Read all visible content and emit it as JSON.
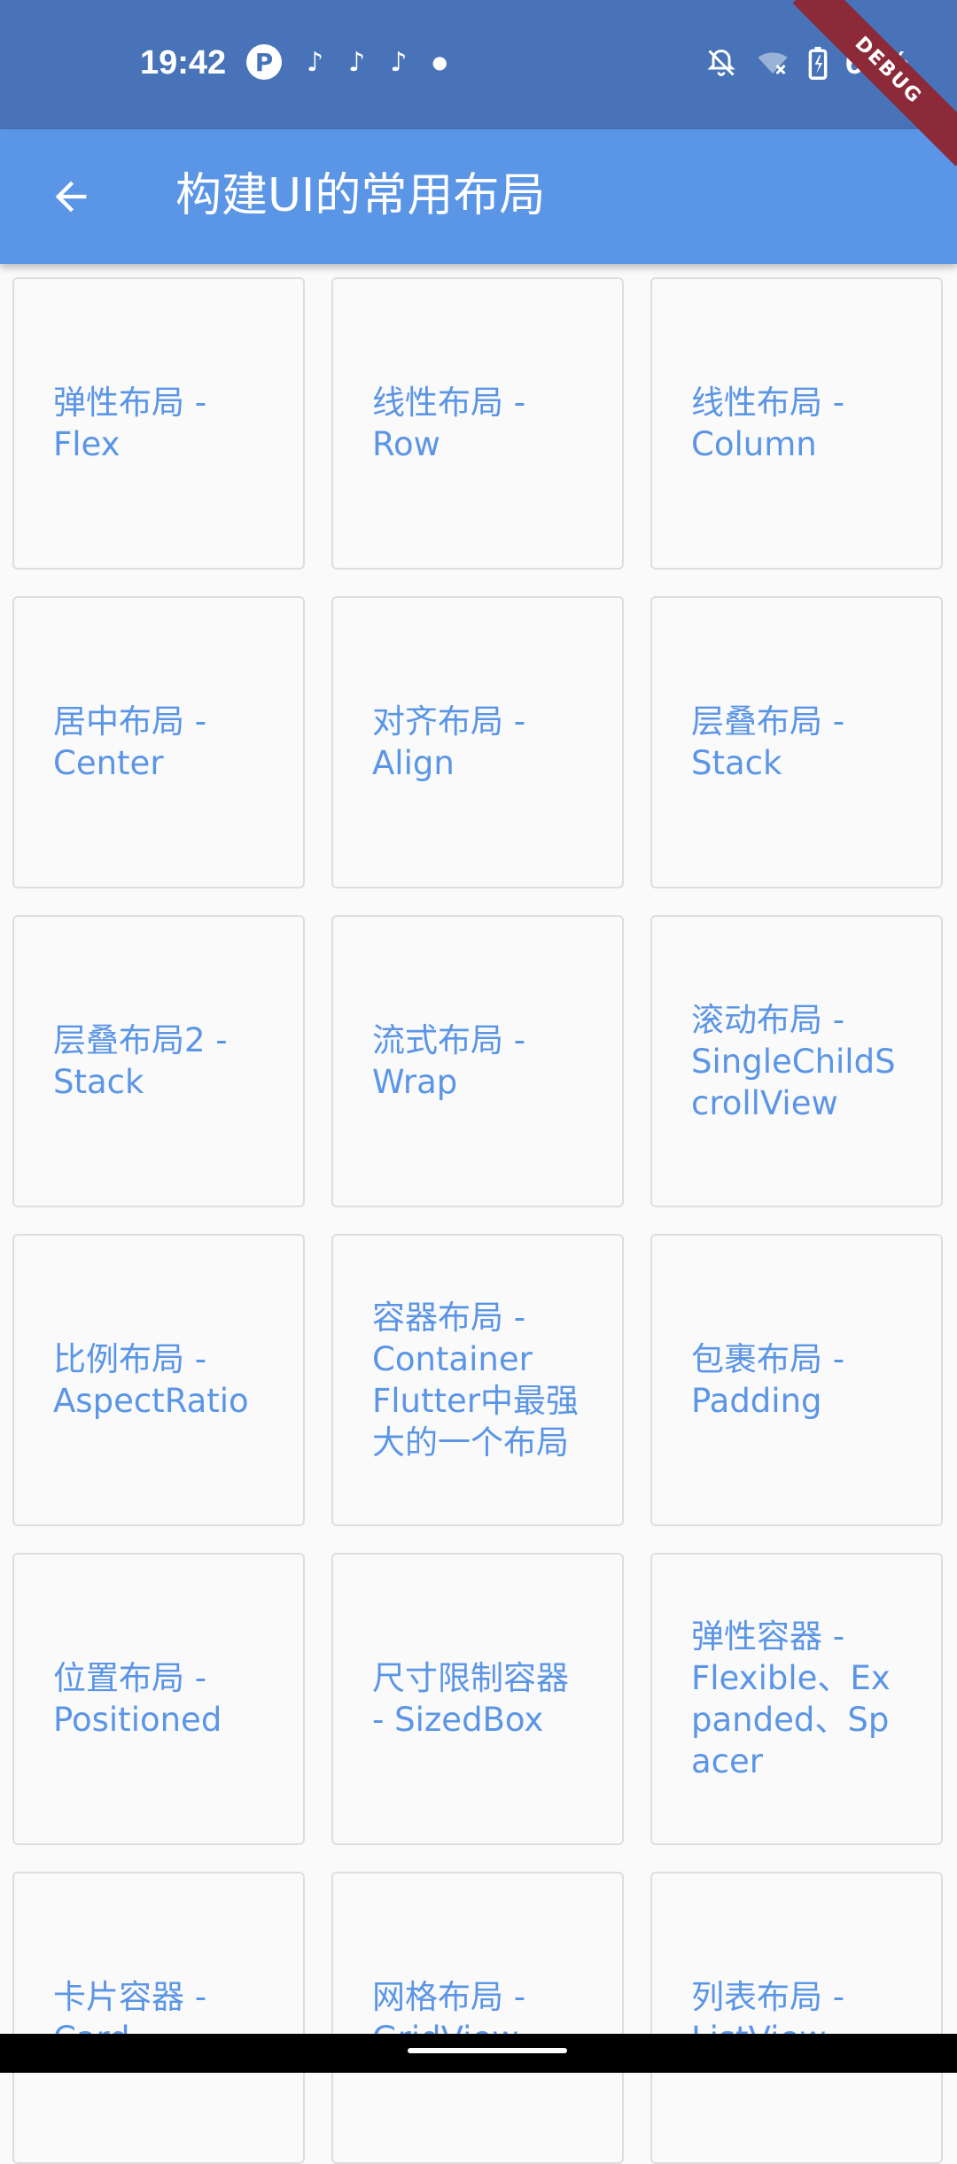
{
  "status_bar": {
    "time": "19:42",
    "battery": "65%",
    "debug": "DEBUG",
    "icons": [
      "p-icon",
      "tiktok-icon",
      "tiktok-icon",
      "tiktok-icon",
      "dot-icon",
      "bell-off-icon",
      "wifi-off-icon",
      "battery-charging-icon"
    ]
  },
  "app_bar": {
    "title": "构建UI的常用布局",
    "back_icon": "arrow-left-icon"
  },
  "cards": [
    {
      "label": "弹性布局 -\nFlex"
    },
    {
      "label": "线性布局 -\nRow"
    },
    {
      "label": "线性布局 -\nColumn"
    },
    {
      "label": "居中布局 -\nCenter"
    },
    {
      "label": "对齐布局 -\nAlign"
    },
    {
      "label": "层叠布局 -\nStack"
    },
    {
      "label": "层叠布局2 -\nStack"
    },
    {
      "label": "流式布局 -\nWrap"
    },
    {
      "label": "滚动布局 -\nSingleChildScrollView"
    },
    {
      "label": "比例布局 -\nAspectRatio"
    },
    {
      "label": "容器布局 -\nContainer\nFlutter中最强大的一个布局"
    },
    {
      "label": "包裹布局 -\nPadding"
    },
    {
      "label": "位置布局 -\nPositioned"
    },
    {
      "label": "尺寸限制容器\n- SizedBox"
    },
    {
      "label": "弹性容器 -\nFlexible、Expanded、Spacer"
    },
    {
      "label": "卡片容器 -\nCard"
    },
    {
      "label": "网格布局 -\nGridView"
    },
    {
      "label": "列表布局 -\nListView"
    }
  ],
  "colors": {
    "status_bar": "#4873b8",
    "app_bar": "#5b95e6",
    "card_text": "#5b95e6",
    "card_border": "#dedede",
    "debug_ribbon": "#8c2a3a"
  }
}
